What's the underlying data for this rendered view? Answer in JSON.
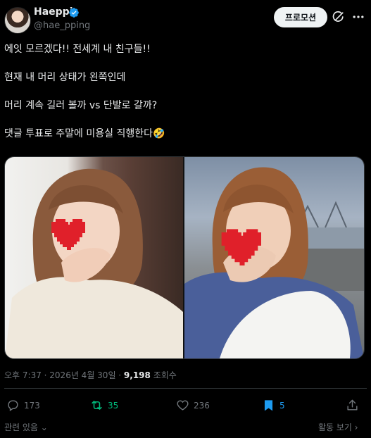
{
  "author": {
    "display_name": "Haeppi",
    "handle": "@hae_pping"
  },
  "header": {
    "promote_label": "프로모션"
  },
  "tweet": {
    "lines": [
      "에잇 모르겠다!! 전세계 내 친구들!!",
      "",
      "현재 내 머리 상태가 왼쪽인데",
      "",
      "머리 계속 길러 볼까 vs 단발로 갈까?",
      "",
      "댓글 투표로 주말에 미용실 직행한다🤣"
    ]
  },
  "meta": {
    "time": "오후 7:37 · 2026년 4월 30일 · ",
    "views": "9,198",
    "views_label": " 조회수"
  },
  "actions": {
    "replies": "173",
    "reposts": "35",
    "likes": "236",
    "bookmarks": "5"
  },
  "footer": {
    "related": "관련 있음",
    "activity": "활동 보기"
  },
  "colors": {
    "background": "#000000",
    "text": "#e7e9ea",
    "muted": "#71767b",
    "repost": "#00ba7c",
    "bookmark": "#1d9bf0",
    "verified": "#1d9bf0",
    "heart_sticker": "#e0202a"
  }
}
